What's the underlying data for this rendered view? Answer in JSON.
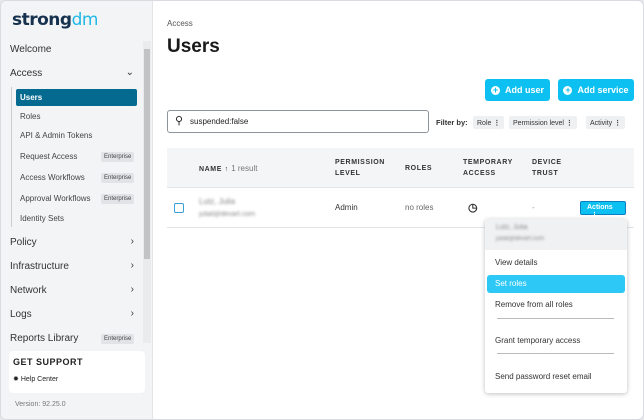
{
  "brand": {
    "logo_a": "strong",
    "logo_b": "dm"
  },
  "sidebar": {
    "items": [
      {
        "label": "Welcome"
      },
      {
        "label": "Access"
      },
      {
        "label": "Policy"
      },
      {
        "label": "Infrastructure"
      },
      {
        "label": "Network"
      },
      {
        "label": "Logs"
      },
      {
        "label": "Reports Library",
        "badge": "Enterprise"
      }
    ],
    "access_sub": [
      {
        "label": "Users"
      },
      {
        "label": "Roles"
      },
      {
        "label": "API & Admin Tokens"
      },
      {
        "label": "Request Access",
        "badge": "Enterprise"
      },
      {
        "label": "Access Workflows",
        "badge": "Enterprise"
      },
      {
        "label": "Approval Workflows",
        "badge": "Enterprise"
      },
      {
        "label": "Identity Sets"
      }
    ],
    "support_title": "GET SUPPORT",
    "help_center": "Help Center",
    "version": "Version: 92.25.0"
  },
  "main": {
    "breadcrumb": "Access",
    "title": "Users",
    "add_user": "Add user",
    "add_service": "Add service",
    "search_value": "suspended:false",
    "filter_label": "Filter by:",
    "filters": [
      "Role",
      "Permission level",
      "Activity"
    ],
    "table": {
      "headers": {
        "name": "NAME",
        "result_count": "1 result",
        "permission_a": "PERMISSION",
        "permission_b": "LEVEL",
        "roles": "ROLES",
        "temp_a": "TEMPORARY",
        "temp_b": "ACCESS",
        "device_a": "DEVICE",
        "device_b": "TRUST"
      },
      "rows": [
        {
          "name": "Lutz, Julia",
          "email": "juliat@devart.com",
          "permission": "Admin",
          "roles": "no roles",
          "device": "-",
          "actions": "Actions"
        }
      ]
    },
    "menu": {
      "name": "Lutz, Julia",
      "email": "juliat@devart.com",
      "items": [
        "View details",
        "Set roles",
        "Remove from all roles",
        "Grant temporary access",
        "Send password reset email"
      ]
    }
  },
  "colors": {
    "accent": "#0cc0f2",
    "active_nav": "#046a8f"
  }
}
